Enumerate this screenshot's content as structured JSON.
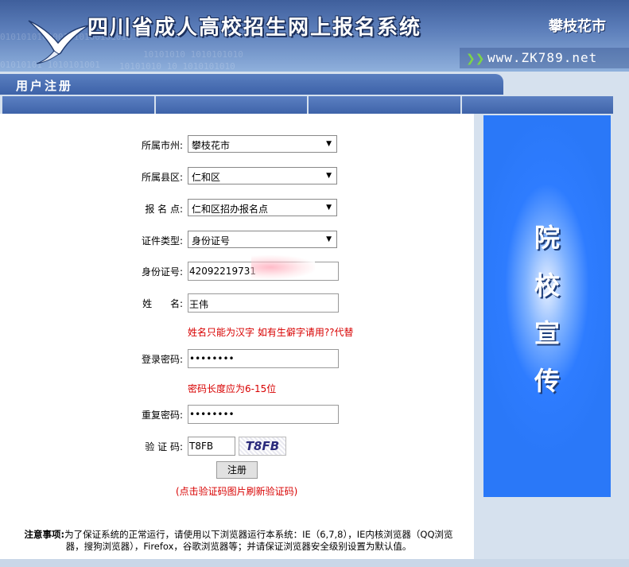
{
  "header": {
    "title": "四川省成人高校招生网上报名系统",
    "city": "攀枝花市",
    "url": "www.ZK789.net",
    "binary_text": [
      "0101010101001010100101010",
      "10101010  1010101010",
      "01010101  1010101001",
      "10101010 10 1010101010"
    ]
  },
  "section": {
    "title": "用户注册"
  },
  "form": {
    "city": {
      "label": "所属市州:",
      "value": "攀枝花市"
    },
    "county": {
      "label": "所属县区:",
      "value": "仁和区"
    },
    "site": {
      "label": "报 名 点:",
      "value": "仁和区招办报名点"
    },
    "id_type": {
      "label": "证件类型:",
      "value": "身份证号"
    },
    "id_number": {
      "label": "身份证号:",
      "value": "42092219731"
    },
    "name": {
      "label": "姓      名:",
      "value": "王伟",
      "hint": "姓名只能为汉字 如有生僻字请用??代替"
    },
    "password": {
      "label": "登录密码:",
      "value": "••••••••",
      "hint": "密码长度应为6-15位"
    },
    "password_confirm": {
      "label": "重复密码:",
      "value": "••••••••"
    },
    "captcha": {
      "label": "验 证 码:",
      "value": "T8FB",
      "image_text": "T8FB"
    },
    "submit_label": "注册",
    "refresh_tip": "(点击验证码图片刷新验证码)"
  },
  "notice": {
    "heading": "注意事项:",
    "text": "为了保证系统的正常运行，请使用以下浏览器运行本系统：IE（6,7,8），IE内核浏览器（QQ浏览器，搜狗浏览器），Firefox，谷歌浏览器等；并请保证浏览器安全级别设置为默认值。"
  },
  "promo": {
    "text": "院校宣传"
  },
  "colors": {
    "accent": "#3d62a8",
    "error": "#d80000",
    "promo": "#2e7cff"
  }
}
